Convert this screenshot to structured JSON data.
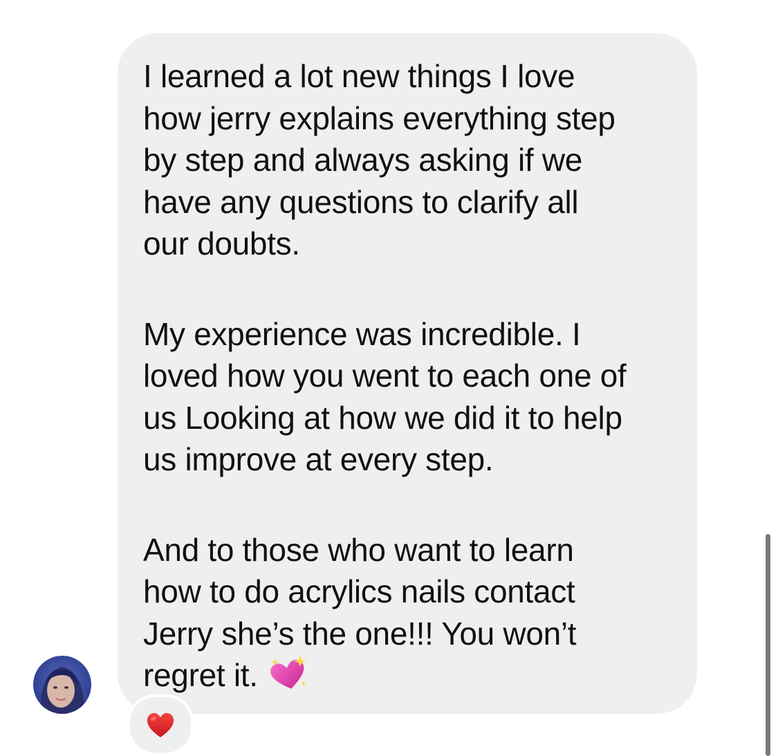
{
  "message": {
    "paragraphs": [
      "I learned a lot new things I love\nhow jerry  explains everything step\nby step and always asking if we\nhave any questions to clarify all\nour doubts.",
      "My experience was incredible. I\nloved how you went to each one of\nus Looking at how we did it to help\nus improve at every step.",
      "And to those who want to learn\nhow to do acrylics nails contact\nJerry she’s the one!!! You won’t\nregret it."
    ],
    "emoji": "sparkling-heart"
  },
  "reaction": {
    "emoji": "red-heart"
  },
  "avatar": {
    "icon": "user-avatar"
  },
  "colors": {
    "bubble": "#efefef",
    "text": "#111111",
    "heart": "#e0262f",
    "sparkling_heart": "#e64fb4",
    "scrollbar": "#7a7a7a"
  }
}
